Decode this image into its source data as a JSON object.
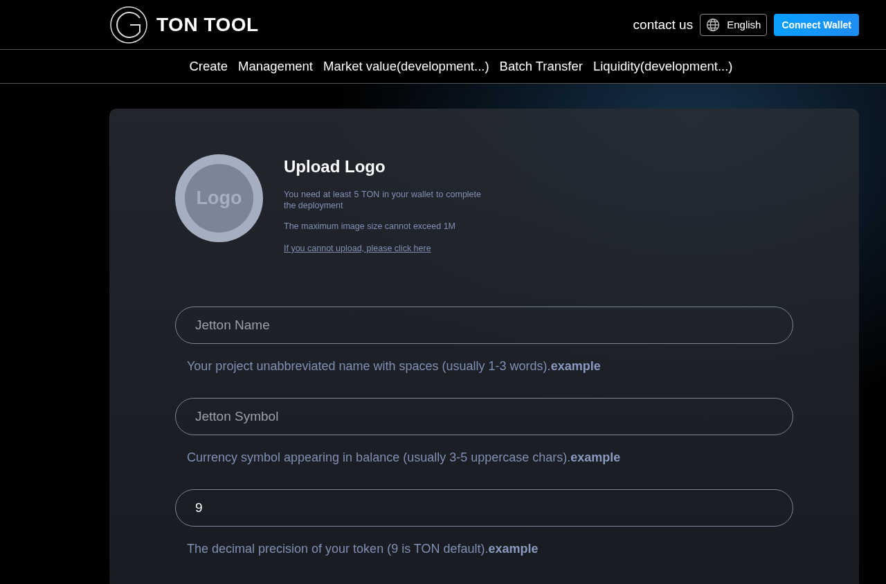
{
  "header": {
    "brand": "TON TOOL",
    "contact": "contact us",
    "language": "English",
    "connect_button": "Connect Wallet"
  },
  "nav": [
    {
      "label": "Create"
    },
    {
      "label": "Management"
    },
    {
      "label": "Market value(development...)"
    },
    {
      "label": "Batch Transfer"
    },
    {
      "label": "Liquidity(development...)"
    }
  ],
  "upload": {
    "placeholder_logo": "Logo",
    "title": "Upload Logo",
    "notes": [
      "You need at least 5 TON in your wallet to complete the deployment",
      "The maximum image size cannot exceed 1M"
    ],
    "link": "If you cannot upload, please click here"
  },
  "fields": [
    {
      "placeholder": "Jetton Name",
      "hint": "Your project unabbreviated name with spaces (usually 1-3 words).**example**"
    },
    {
      "placeholder": "Jetton Symbol",
      "hint": "Currency symbol appearing in balance (usually 3-5 uppercase chars).**example**"
    },
    {
      "value": "9",
      "hint": "The decimal precision of your token (9 is TON default).**example**"
    }
  ]
}
